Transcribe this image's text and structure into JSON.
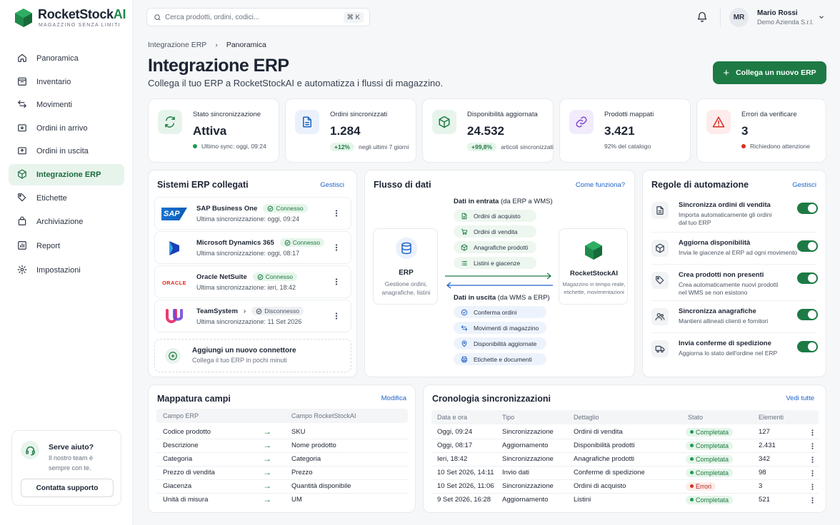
{
  "brand": {
    "name_a": "RocketStock",
    "name_b": "AI",
    "tagline": "MAGAZZINO SENZA LIMITI"
  },
  "search": {
    "placeholder": "Cerca prodotti, ordini, codici...",
    "shortcut": "⌘ K"
  },
  "user": {
    "initials": "MR",
    "name": "Mario Rossi",
    "company": "Demo Azienda S.r.l."
  },
  "nav": [
    {
      "label": "Panoramica",
      "icon": "home-icon"
    },
    {
      "label": "Inventario",
      "icon": "inventory-icon"
    },
    {
      "label": "Movimenti",
      "icon": "swap-icon"
    },
    {
      "label": "Ordini in arrivo",
      "icon": "inbound-icon"
    },
    {
      "label": "Ordini in uscita",
      "icon": "outbound-icon"
    },
    {
      "label": "Integrazione ERP",
      "icon": "integration-icon",
      "active": true
    },
    {
      "label": "Etichette",
      "icon": "tag-icon"
    },
    {
      "label": "Archiviazione",
      "icon": "archive-icon"
    },
    {
      "label": "Report",
      "icon": "chart-icon"
    },
    {
      "label": "Impostazioni",
      "icon": "gear-icon"
    }
  ],
  "help": {
    "title": "Serve aiuto?",
    "text1": "Il nostro team è",
    "text2": "sempre con te.",
    "button": "Contatta supporto"
  },
  "breadcrumb": {
    "parent": "Integrazione ERP",
    "current": "Panoramica"
  },
  "page": {
    "title": "Integrazione ERP",
    "subtitle": "Collega il tuo ERP a RocketStockAI e automatizza i flussi di magazzino.",
    "cta": "Collega un nuovo ERP"
  },
  "kpis": [
    {
      "label": "Stato sincronizzazione",
      "value": "Attiva",
      "note": "Ultimo sync: oggi, 09:24",
      "icon": "sync-icon"
    },
    {
      "label": "Ordini sincronizzati",
      "value": "1.284",
      "badge": "+12%",
      "note": "negli ultimi 7 giorni",
      "icon": "document-icon"
    },
    {
      "label": "Disponibilità aggiornata",
      "value": "24.532",
      "badge": "+99,8%",
      "note": "articoli sincronizzati",
      "icon": "box-icon"
    },
    {
      "label": "Prodotti mappati",
      "value": "3.421",
      "note": "92% del catalogo",
      "icon": "link-icon"
    },
    {
      "label": "Errori da verificare",
      "value": "3",
      "note": "Richiedono attenzione",
      "icon": "warning-icon"
    }
  ],
  "erp": {
    "title": "Sistemi ERP collegati",
    "manage": "Gestisci",
    "items": [
      {
        "name": "SAP Business One",
        "status": "Connesso",
        "sync": "Ultima sincronizzazione: oggi, 09:24",
        "logo": "SAP"
      },
      {
        "name": "Microsoft Dynamics 365",
        "status": "Connesso",
        "sync": "Ultima sincronizzazione: oggi, 08:17",
        "logo": ""
      },
      {
        "name": "Oracle NetSuite",
        "status": "Connesso",
        "sync": "Ultima sincronizzazione: ieri, 18:42",
        "logo": "ORACLE"
      },
      {
        "name": "TeamSystem",
        "status": "Disconnesso",
        "sync": "Ultima sincronizzazione: 11 Set 2026",
        "logo": ""
      }
    ],
    "add_title": "Aggiungi un nuovo connettore",
    "add_sub": "Collega il tuo ERP in pochi minuti"
  },
  "flow": {
    "title": "Flusso di dati",
    "help": "Come funziona?",
    "in_title": "Dati in entrata",
    "in_sub": "(da ERP a WMS)",
    "in_items": [
      "Ordini di acquisto",
      "Ordini di vendita",
      "Anagrafiche prodotti",
      "Listini e giacenze"
    ],
    "out_title": "Dati in uscita",
    "out_sub": "(da WMS a ERP)",
    "out_items": [
      "Conferma ordini",
      "Movimenti di magazzino",
      "Disponibilità aggiornate",
      "Etichette e documenti"
    ],
    "erp_box": {
      "title": "ERP",
      "desc1": "Gestione ordini,",
      "desc2": "anagrafiche, listini"
    },
    "wms_box": {
      "title": "RocketStockAI",
      "desc1": "Magazzino in tempo reale,",
      "desc2": "etichette, movimentazioni"
    }
  },
  "rules": {
    "title": "Regole di automazione",
    "manage": "Gestisci",
    "items": [
      {
        "title": "Sincronizza ordini di vendita",
        "desc1": "Importa automaticamente gli ordini",
        "desc2": "dal tuo ERP",
        "icon": "document-icon",
        "on": true
      },
      {
        "title": "Aggiorna disponibilità",
        "desc1": "Invia le giacenze al ERP ad ogni movimento",
        "desc2": "",
        "icon": "box-icon",
        "on": true
      },
      {
        "title": "Crea prodotti non presenti",
        "desc1": "Crea automaticamente nuovi prodotti",
        "desc2": "nel WMS se non esistono",
        "icon": "tag-icon",
        "on": true
      },
      {
        "title": "Sincronizza anagrafiche",
        "desc1": "Mantieni allineati clienti e fornitori",
        "desc2": "",
        "icon": "users-icon",
        "on": true
      },
      {
        "title": "Invia conferme di spedizione",
        "desc1": "Aggiorna lo stato dell'ordine nel ERP",
        "desc2": "",
        "icon": "truck-icon",
        "on": true
      }
    ]
  },
  "mapping": {
    "title": "Mappatura campi",
    "edit": "Modifica",
    "headers": [
      "Campo ERP",
      "Campo RocketStockAI"
    ],
    "rows": [
      [
        "Codice prodotto",
        "SKU"
      ],
      [
        "Descrizione",
        "Nome prodotto"
      ],
      [
        "Categoria",
        "Categoria"
      ],
      [
        "Prezzo di vendita",
        "Prezzo"
      ],
      [
        "Giacenza",
        "Quantità disponibile"
      ],
      [
        "Unità di misura",
        "UM"
      ]
    ]
  },
  "history": {
    "title": "Cronologia sincronizzazioni",
    "view_all": "Vedi tutte",
    "headers": [
      "Data e ora",
      "Tipo",
      "Dettaglio",
      "Stato",
      "Elementi"
    ],
    "rows": [
      {
        "date": "Oggi, 09:24",
        "type": "Sincronizzazione",
        "detail": "Ordini di vendita",
        "status": "Completata",
        "count": "127",
        "ok": true
      },
      {
        "date": "Oggi, 08:17",
        "type": "Aggiornamento",
        "detail": "Disponibilità prodotti",
        "status": "Completata",
        "count": "2.431",
        "ok": true
      },
      {
        "date": "Ieri, 18:42",
        "type": "Sincronizzazione",
        "detail": "Anagrafiche prodotti",
        "status": "Completata",
        "count": "342",
        "ok": true
      },
      {
        "date": "10 Set 2026, 14:11",
        "type": "Invio dati",
        "detail": "Conferme di spedizione",
        "status": "Completata",
        "count": "98",
        "ok": true
      },
      {
        "date": "10 Set 2026, 11:06",
        "type": "Sincronizzazione",
        "detail": "Ordini di acquisto",
        "status": "Errori",
        "count": "3",
        "ok": false
      },
      {
        "date": "9 Set 2026, 16:28",
        "type": "Aggiornamento",
        "detail": "Listini",
        "status": "Completata",
        "count": "521",
        "ok": true
      }
    ]
  },
  "colors": {
    "accent": "#1d7a44",
    "link": "#1f63c6",
    "error": "#d92d20"
  }
}
